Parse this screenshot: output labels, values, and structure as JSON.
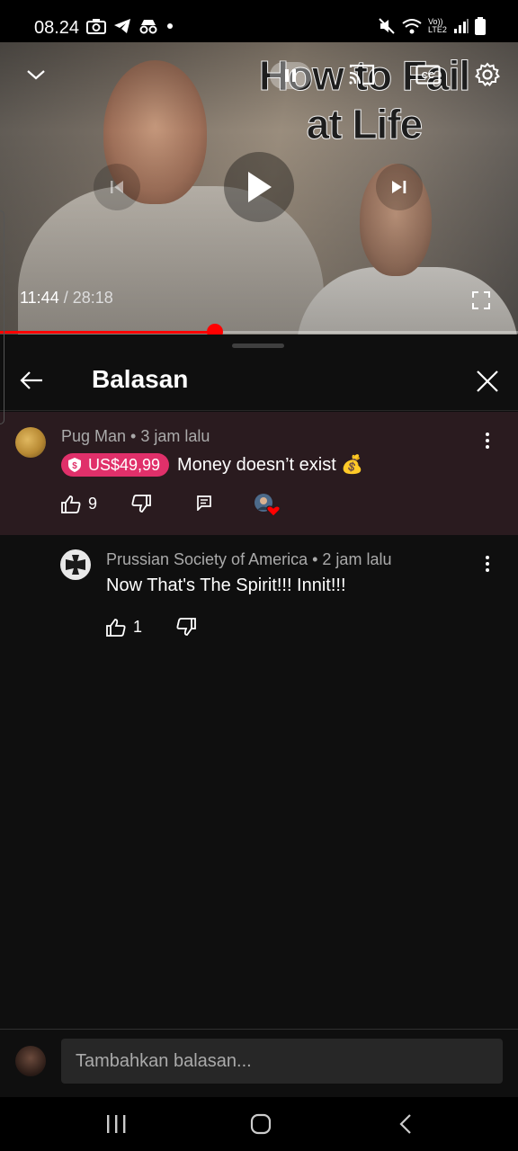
{
  "status_bar": {
    "time": "08.24",
    "network_label": "Vo)) LTE2"
  },
  "video": {
    "overlay_text": "How to Fail at Life",
    "current_time": "11:44",
    "separator": " / ",
    "duration": "28:18",
    "progress_fraction": 0.4145
  },
  "panel": {
    "title": "Balasan"
  },
  "comment": {
    "author": "Pug Man",
    "time": "3 jam lalu",
    "separator": " • ",
    "superchat_amount": "US$49,99",
    "text": "Money doesn’t exist 💰",
    "likes": "9"
  },
  "reply": {
    "author": "Prussian Society of America",
    "time": "2 jam lalu",
    "separator": " • ",
    "text": "Now That's The Spirit!!! Innit!!!",
    "likes": "1"
  },
  "reply_input": {
    "placeholder": "Tambahkan balasan..."
  },
  "colors": {
    "accent_red": "#ff0000",
    "superchat_pink": "#e0306a",
    "highlight_bg": "#2a1b1f"
  }
}
